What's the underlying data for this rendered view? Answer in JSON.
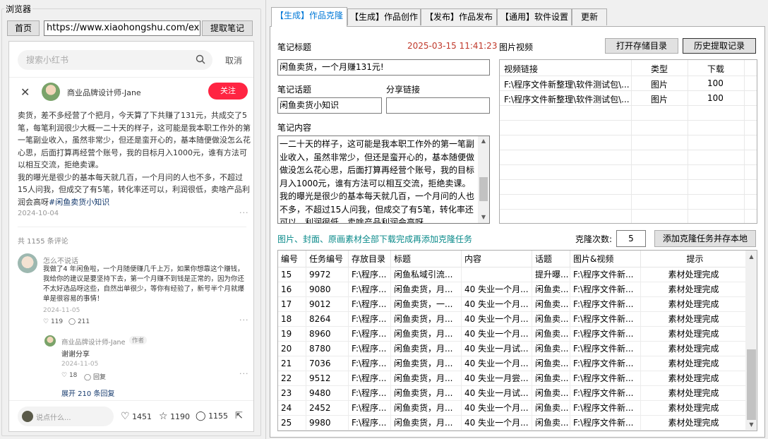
{
  "browser": {
    "group_title": "浏览器",
    "home_label": "首页",
    "url": "https://www.xiaohongshu.com/explore",
    "extract_label": "提取笔记"
  },
  "xhs": {
    "search_placeholder": "搜索小红书",
    "cancel_label": "取消",
    "author_name": "商业品牌设计师-Jane",
    "follow_label": "关注",
    "note_body": "卖货，差不多经营了个把月，今天算了下共赚了131元，共成交了5笔，每笔利润很少大概一二十天的样子，这可能是我本职工作外的第一笔副业收入，虽然非常少，但还是蛮开心的，基本随便做没怎么花心思，后面打算再经营个账号，我的目标月入1000元，谁有方法可以相互交流，拒绝卖课。\n我的曝光是很少的基本每天就几百，一个月问的人也不多，不超过15人问我，但成交了有5笔，转化率还可以，利润很低，卖啥产品利润会高呀",
    "note_tag": "#闲鱼卖货小知识",
    "note_date": "2024-10-04",
    "comment_count": "共 1155 条评论",
    "comment1": {
      "name": "怎么不说话",
      "text": "我做了4 年闲鱼啦，一个月随便赚几千上万，如果你想靠这个赚钱，我给你的建议是要坚持下去，第一个月赚不到钱是正常的，因为你还不太好选品呀这些，自然出单很少，等你有经验了，新号半个月就爆单是很容易的事情！",
      "date": "2024-11-05",
      "likes": "119",
      "replies": "211"
    },
    "reply1": {
      "name": "商业品牌设计师-Jane",
      "badge": "作者",
      "text": "谢谢分享",
      "date": "2024-11-05",
      "likes": "18",
      "reply_label": "回复"
    },
    "expand_label": "展开 210 条回复",
    "comment_placeholder": "说点什么...",
    "stats": {
      "likes": "1451",
      "collects": "1190",
      "comments": "1155"
    }
  },
  "tabs": [
    {
      "label": "【生成】作品克隆",
      "active": true
    },
    {
      "label": "【生成】作品创作",
      "active": false
    },
    {
      "label": "【发布】作品发布",
      "active": false
    },
    {
      "label": "【通用】软件设置",
      "active": false
    },
    {
      "label": "更新",
      "active": false
    }
  ],
  "clone": {
    "title_label": "笔记标题",
    "timestamp": "2025-03-15 11:41:23",
    "title_value": "闲鱼卖货，一个月赚131元!",
    "topic_label": "笔记话题",
    "share_label": "分享链接",
    "topic_value": "闲鱼卖货小知识",
    "share_value": "",
    "content_label": "笔记内容",
    "content_value": "一二十天的样子，这可能是我本职工作外的第一笔副业收入，虽然非常少，但还是蛮开心的，基本随便做做没怎么花心思，后面打算再经营个账号，我的目标月入1000元，谁有方法可以相互交流，拒绝卖课。\n我的曝光是很少的基本每天就几百，一个月问的人也不多，不超过15人问我，但成交了有5笔，转化率还可以，利润很低，卖啥产品利润会高呀",
    "media_label": "图片视频",
    "open_dir_label": "打开存储目录",
    "history_label": "历史提取记录",
    "media_columns": [
      "视频链接",
      "类型",
      "下载"
    ],
    "media_rows": [
      [
        "F:\\程序文件新整理\\软件测试包\\...",
        "图片",
        "100"
      ],
      [
        "F:\\程序文件新整理\\软件测试包\\...",
        "图片",
        "100"
      ]
    ],
    "notice": "图片、封面、原画素材全部下载完成再添加克隆任务",
    "clone_count_label": "克隆次数:",
    "clone_count_value": "5",
    "add_task_label": "添加克隆任务并存本地",
    "task_columns": [
      "编号",
      "任务编号",
      "存放目录",
      "标题",
      "内容",
      "话题",
      "图片&视频",
      "提示"
    ],
    "task_rows": [
      [
        "15",
        "9972",
        "F:\\程序...",
        "闲鱼私域引流...",
        "",
        "提升曝...",
        "F:\\程序文件新...",
        "素材处理完成"
      ],
      [
        "16",
        "9080",
        "F:\\程序...",
        "闲鱼卖货，月...",
        "40 失业一个月...",
        "闲鱼卖...",
        "F:\\程序文件新...",
        "素材处理完成"
      ],
      [
        "17",
        "9012",
        "F:\\程序...",
        "闲鱼卖货，一...",
        "40 失业一个月...",
        "闲鱼卖...",
        "F:\\程序文件新...",
        "素材处理完成"
      ],
      [
        "18",
        "8264",
        "F:\\程序...",
        "闲鱼卖货，月...",
        "40 失业一个月...",
        "闲鱼卖...",
        "F:\\程序文件新...",
        "素材处理完成"
      ],
      [
        "19",
        "8960",
        "F:\\程序...",
        "闲鱼卖货，月...",
        "40 失业一个月...",
        "闲鱼卖...",
        "F:\\程序文件新...",
        "素材处理完成"
      ],
      [
        "20",
        "8780",
        "F:\\程序...",
        "闲鱼卖货，月...",
        "40 失业一月试...",
        "闲鱼卖...",
        "F:\\程序文件新...",
        "素材处理完成"
      ],
      [
        "21",
        "7036",
        "F:\\程序...",
        "闲鱼卖货，月...",
        "40 失业一个月...",
        "闲鱼卖...",
        "F:\\程序文件新...",
        "素材处理完成"
      ],
      [
        "22",
        "9512",
        "F:\\程序...",
        "闲鱼卖货，月...",
        "40 失业一月尝...",
        "闲鱼卖...",
        "F:\\程序文件新...",
        "素材处理完成"
      ],
      [
        "23",
        "9480",
        "F:\\程序...",
        "闲鱼卖货，月...",
        "40 失业一月试...",
        "闲鱼卖...",
        "F:\\程序文件新...",
        "素材处理完成"
      ],
      [
        "24",
        "2452",
        "F:\\程序...",
        "闲鱼卖货，月...",
        "40 失业一个月...",
        "闲鱼卖...",
        "F:\\程序文件新...",
        "素材处理完成"
      ],
      [
        "25",
        "9980",
        "F:\\程序...",
        "闲鱼卖货，月...",
        "40 失业一个月...",
        "闲鱼卖...",
        "F:\\程序文件新...",
        "素材处理完成"
      ]
    ]
  },
  "colors": {
    "accent_red": "#ff2442",
    "tab_blue": "#0078d7",
    "notice_teal": "#0a8a8a",
    "timestamp_red": "#c0392b"
  }
}
